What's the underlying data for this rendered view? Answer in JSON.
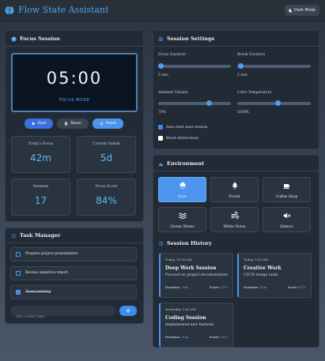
{
  "app": {
    "title": "Flow State Assistant",
    "dark_mode_label": "Dark Mode"
  },
  "focus": {
    "title": "Focus Session",
    "timer": "05:00",
    "mode": "FOCUS MODE",
    "buttons": {
      "start": "Start",
      "pause": "Pause",
      "reset": "Reset"
    },
    "stats": [
      {
        "label": "Today's Focus",
        "value": "42m"
      },
      {
        "label": "Current Streak",
        "value": "5d"
      },
      {
        "label": "Sessions",
        "value": "17"
      },
      {
        "label": "Focus Score",
        "value": "84%"
      }
    ]
  },
  "settings": {
    "title": "Session Settings",
    "focus_duration": {
      "label": "Focus Duration",
      "value": "5 min",
      "fraction": 0.03
    },
    "break_duration": {
      "label": "Break Duration",
      "value": "5 min",
      "fraction": 0.05
    },
    "ambient_volume": {
      "label": "Ambient Volume",
      "value": "70%",
      "fraction": 0.7
    },
    "color_temperature": {
      "label": "Color Temperature",
      "value": "5000K",
      "fraction": 0.55
    },
    "auto_start": {
      "label": "Auto-start next session",
      "checked": true
    },
    "block_distractions": {
      "label": "Block distractions",
      "checked": false
    }
  },
  "environment": {
    "title": "Environment",
    "items": [
      {
        "label": "Rain",
        "icon": "cloud-rain-icon",
        "active": true
      },
      {
        "label": "Forest",
        "icon": "tree-icon",
        "active": false
      },
      {
        "label": "Coffee Shop",
        "icon": "coffee-icon",
        "active": false
      },
      {
        "label": "Ocean Waves",
        "icon": "waves-icon",
        "active": false
      },
      {
        "label": "White Noise",
        "icon": "wind-icon",
        "active": false
      },
      {
        "label": "Silence",
        "icon": "mute-icon",
        "active": false
      }
    ]
  },
  "history": {
    "title": "Session History",
    "entries": [
      {
        "date": "Today, 10:30 AM",
        "title": "Deep Work Session",
        "subtitle": "Focused on project documentation",
        "duration_label": "Duration:",
        "duration": "25m",
        "score_label": "Score:",
        "score": "92%"
      },
      {
        "date": "Today, 9:15 AM",
        "title": "Creative Work",
        "subtitle": "UI/UX design tasks",
        "duration_label": "Duration:",
        "duration": "45m",
        "score_label": "Score:",
        "score": "87%"
      },
      {
        "date": "Yesterday, 2:00 PM",
        "title": "Coding Session",
        "subtitle": "Implemented new features",
        "duration_label": "Duration:",
        "duration": "30m",
        "score_label": "Score:",
        "score": "95%"
      }
    ]
  },
  "tasks": {
    "title": "Task Manager",
    "items": [
      {
        "label": "Prepare project presentation",
        "done": false
      },
      {
        "label": "Review analytics report",
        "done": false
      },
      {
        "label": "Team meeting",
        "done": true
      }
    ],
    "placeholder": "Add a new task...",
    "add_label": "+"
  },
  "colors": {
    "accent": "#4b95ee",
    "panel": "#212a35",
    "highlight": "#58a6ea"
  }
}
